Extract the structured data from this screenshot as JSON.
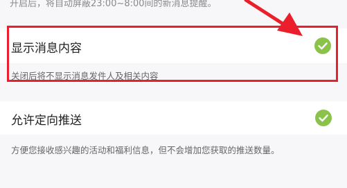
{
  "top_note": "开启后，将自动屏蔽23:00~8:00间的新消息提醒。",
  "show_message_content": {
    "label": "显示消息内容",
    "description": "关闭后将不显示消息发件人及相关内容",
    "checked": true
  },
  "allow_targeted_push": {
    "label": "允许定向推送",
    "description": "方便您接收感兴趣的活动和福利信息，但不会增加您获取的推送数量。",
    "checked": true
  },
  "colors": {
    "check_green": "#8bc34a",
    "annotation_red": "#ea1f2b",
    "page_background": "#f7f6f8"
  },
  "icons": [
    "check-circle-icon",
    "red-arrow-annotation"
  ]
}
